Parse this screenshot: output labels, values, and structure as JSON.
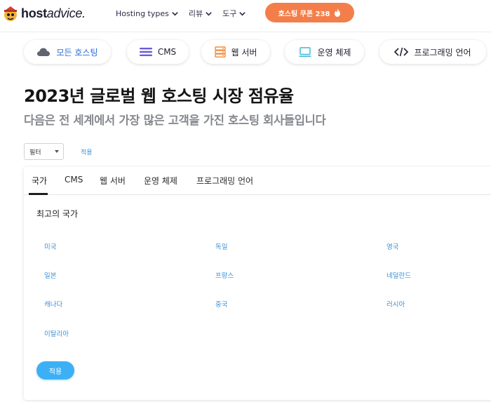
{
  "header": {
    "logo_bold": "host",
    "logo_italic": "advice.",
    "nav": [
      {
        "label": "Hosting types"
      },
      {
        "label": "리뷰"
      },
      {
        "label": "도구"
      }
    ],
    "coupon_label": "호스팅 쿠폰 238"
  },
  "categories": [
    {
      "label": "모든 호스팅",
      "icon": "cloud-icon"
    },
    {
      "label": "CMS",
      "icon": "menu-lines-icon"
    },
    {
      "label": "웹 서버",
      "icon": "server-icon"
    },
    {
      "label": "운영 체제",
      "icon": "laptop-icon"
    },
    {
      "label": "프로그래밍 언어",
      "icon": "code-icon"
    }
  ],
  "page": {
    "title": "2023년 글로벌 웹 호스팅 시장 점유율",
    "subtitle": "다음은 전 세계에서 가장 많은 고객을 가진 호스팅 회사들입니다"
  },
  "filter": {
    "select_value": "필터",
    "apply_link": "적용"
  },
  "panel": {
    "tabs": [
      "국가",
      "CMS",
      "웹 서버",
      "운영 체제",
      "프로그래밍 언어"
    ],
    "section_title": "최고의 국가",
    "countries": [
      "미국",
      "독일",
      "영국",
      "일본",
      "프랑스",
      "네덜란드",
      "캐나다",
      "중국",
      "러시아",
      "이탈리아"
    ],
    "apply_button": "적용"
  },
  "colors": {
    "coupon": "#f47e4a",
    "link": "#3a8fd8",
    "active_category": "#2b6cd6",
    "apply_button": "#3db0f5"
  }
}
